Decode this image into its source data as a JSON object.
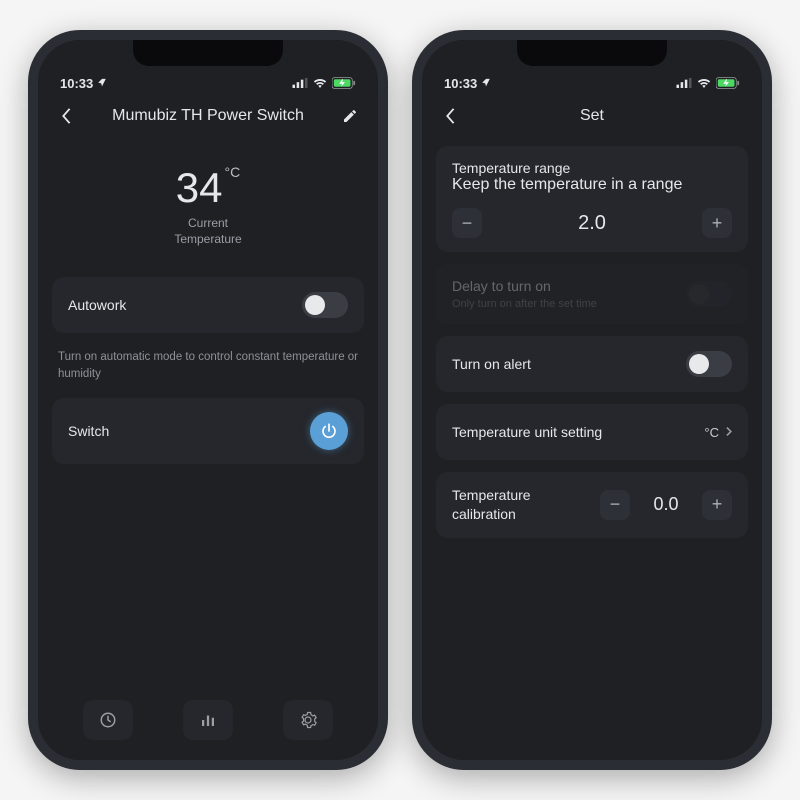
{
  "statusbar": {
    "time": "10:33"
  },
  "left": {
    "title": "Mumubiz TH Power Switch",
    "temp_value": "34",
    "temp_unit": "°C",
    "temp_label1": "Current",
    "temp_label2": "Temperature",
    "autowork_label": "Autowork",
    "autowork_desc": "Turn on automatic mode to control constant temperature or humidity",
    "switch_label": "Switch"
  },
  "right": {
    "title": "Set",
    "range_label": "Temperature range",
    "range_sub": "Keep the temperature in a range",
    "range_value": "2.0",
    "delay_label": "Delay to turn on",
    "delay_sub": "Only turn on after the set time",
    "alert_label": "Turn on alert",
    "unit_label": "Temperature unit setting",
    "unit_value": "°C",
    "calib_label": "Temperature calibration",
    "calib_value": "0.0"
  }
}
